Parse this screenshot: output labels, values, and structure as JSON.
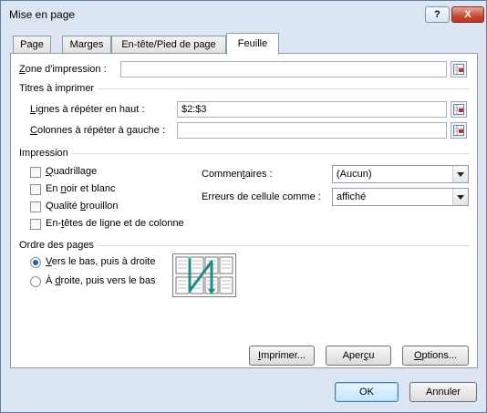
{
  "window": {
    "title": "Mise en page",
    "help_label": "?",
    "close_label": "X"
  },
  "tabs": [
    {
      "label": "Page"
    },
    {
      "label": "Marges"
    },
    {
      "label": "En-tête/Pied de page"
    },
    {
      "label": "Feuille"
    }
  ],
  "print_area": {
    "label_prefix": "Z",
    "label_rest": "one d'impression :",
    "value": ""
  },
  "titles": {
    "group_label": "Titres à imprimer",
    "rows_label_prefix": "L",
    "rows_label_rest": "ignes à répéter en haut :",
    "rows_value": "$2:$3",
    "cols_label_prefix": "C",
    "cols_label_rest": "olonnes à répéter à gauche :",
    "cols_value": ""
  },
  "print": {
    "group_label": "Impression",
    "gridlines": {
      "label_prefix": "Q",
      "label_rest": "uadrillage",
      "checked": false
    },
    "bw": {
      "label_pre": "En ",
      "label_u": "n",
      "label_rest": "oir et blanc",
      "checked": false
    },
    "draft": {
      "label_pre": "Qualité ",
      "label_u": "b",
      "label_rest": "rouillon",
      "checked": false
    },
    "headings": {
      "label_pre": "En-",
      "label_u": "t",
      "label_rest": "êtes de ligne et de colonne",
      "checked": false
    },
    "comments": {
      "label_pre": "Commen",
      "label_u": "t",
      "label_rest": "aires :",
      "value": "(Aucun)"
    },
    "errors": {
      "label_pre": "Erreurs de cellule comme",
      "label_rest": " :",
      "value": "affiché"
    }
  },
  "page_order": {
    "group_label": "Ordre des pages",
    "down_then_over": {
      "label_prefix": "V",
      "label_rest": "ers le bas, puis à droite",
      "selected": true
    },
    "over_then_down": {
      "label_pre": "À ",
      "label_u": "d",
      "label_rest": "roite, puis vers le bas",
      "selected": false
    }
  },
  "buttons": {
    "print": {
      "label_u": "I",
      "label_rest": "mprimer..."
    },
    "preview": {
      "label_pre": "Aper",
      "label_u": "ç",
      "label_rest": "u"
    },
    "options": {
      "label_u": "O",
      "label_rest": "ptions..."
    },
    "ok": "OK",
    "cancel": "Annuler"
  },
  "colors": {
    "accent": "#2e5ea8",
    "arrow_teal": "#1f8a8a"
  },
  "icons": [
    "collapse-dialog-icon",
    "dropdown-arrow-icon",
    "page-order-diagram"
  ]
}
